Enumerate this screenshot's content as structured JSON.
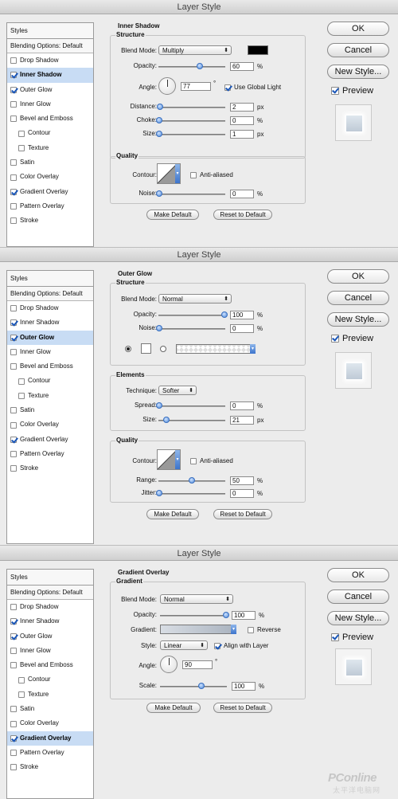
{
  "watermark": {
    "logo_text": "PConline",
    "sub_text": "太平洋电脑网"
  },
  "common": {
    "window_title": "Layer Style",
    "styles_header": "Styles",
    "blending_options": "Blending Options: Default",
    "ok": "OK",
    "cancel": "Cancel",
    "new_style": "New Style...",
    "preview": "Preview"
  },
  "d1": {
    "items": [
      {
        "label": "Drop Shadow",
        "checked": false
      },
      {
        "label": "Inner Shadow",
        "checked": true,
        "selected": true
      },
      {
        "label": "Outer Glow",
        "checked": true
      },
      {
        "label": "Inner Glow",
        "checked": false
      },
      {
        "label": "Bevel and Emboss",
        "checked": false
      },
      {
        "label": "Contour",
        "checked": false,
        "sub": true
      },
      {
        "label": "Texture",
        "checked": false,
        "sub": true
      },
      {
        "label": "Satin",
        "checked": false
      },
      {
        "label": "Color Overlay",
        "checked": false
      },
      {
        "label": "Gradient Overlay",
        "checked": true
      },
      {
        "label": "Pattern Overlay",
        "checked": false
      },
      {
        "label": "Stroke",
        "checked": false
      }
    ],
    "section": "Inner Shadow",
    "structure": "Structure",
    "blend_mode_label": "Blend Mode:",
    "blend_mode": "Multiply",
    "opacity_label": "Opacity:",
    "opacity": "60",
    "angle_label": "Angle:",
    "angle": "77",
    "global_light": "Use Global Light",
    "distance_label": "Distance:",
    "distance": "2",
    "choke_label": "Choke:",
    "choke": "0",
    "size_label": "Size:",
    "size": "1",
    "quality": "Quality",
    "contour_label": "Contour:",
    "anti_aliased": "Anti-aliased",
    "noise_label": "Noise:",
    "noise": "0",
    "make_default": "Make Default",
    "reset_default": "Reset to Default",
    "shadow_color": "#000000"
  },
  "d2": {
    "items": [
      {
        "label": "Drop Shadow",
        "checked": false
      },
      {
        "label": "Inner Shadow",
        "checked": true
      },
      {
        "label": "Outer Glow",
        "checked": true,
        "selected": true
      },
      {
        "label": "Inner Glow",
        "checked": false
      },
      {
        "label": "Bevel and Emboss",
        "checked": false
      },
      {
        "label": "Contour",
        "checked": false,
        "sub": true
      },
      {
        "label": "Texture",
        "checked": false,
        "sub": true
      },
      {
        "label": "Satin",
        "checked": false
      },
      {
        "label": "Color Overlay",
        "checked": false
      },
      {
        "label": "Gradient Overlay",
        "checked": true
      },
      {
        "label": "Pattern Overlay",
        "checked": false
      },
      {
        "label": "Stroke",
        "checked": false
      }
    ],
    "section": "Outer Glow",
    "structure": "Structure",
    "blend_mode_label": "Blend Mode:",
    "blend_mode": "Normal",
    "opacity_label": "Opacity:",
    "opacity": "100",
    "noise_label": "Noise:",
    "noise": "0",
    "elements": "Elements",
    "technique_label": "Technique:",
    "technique": "Softer",
    "spread_label": "Spread:",
    "spread": "0",
    "size_label": "Size:",
    "size": "21",
    "quality": "Quality",
    "contour_label": "Contour:",
    "anti_aliased": "Anti-aliased",
    "range_label": "Range:",
    "range": "50",
    "jitter_label": "Jitter:",
    "jitter": "0",
    "make_default": "Make Default",
    "reset_default": "Reset to Default"
  },
  "d3": {
    "items": [
      {
        "label": "Drop Shadow",
        "checked": false
      },
      {
        "label": "Inner Shadow",
        "checked": true
      },
      {
        "label": "Outer Glow",
        "checked": true
      },
      {
        "label": "Inner Glow",
        "checked": false
      },
      {
        "label": "Bevel and Emboss",
        "checked": false
      },
      {
        "label": "Contour",
        "checked": false,
        "sub": true
      },
      {
        "label": "Texture",
        "checked": false,
        "sub": true
      },
      {
        "label": "Satin",
        "checked": false
      },
      {
        "label": "Color Overlay",
        "checked": false
      },
      {
        "label": "Gradient Overlay",
        "checked": true,
        "selected": true
      },
      {
        "label": "Pattern Overlay",
        "checked": false
      },
      {
        "label": "Stroke",
        "checked": false
      }
    ],
    "section": "Gradient Overlay",
    "gradient_group": "Gradient",
    "blend_mode_label": "Blend Mode:",
    "blend_mode": "Normal",
    "opacity_label": "Opacity:",
    "opacity": "100",
    "gradient_label": "Gradient:",
    "reverse": "Reverse",
    "style_label": "Style:",
    "style": "Linear",
    "align_layer": "Align with Layer",
    "angle_label": "Angle:",
    "angle": "90",
    "scale_label": "Scale:",
    "scale": "100",
    "make_default": "Make Default",
    "reset_default": "Reset to Default"
  }
}
